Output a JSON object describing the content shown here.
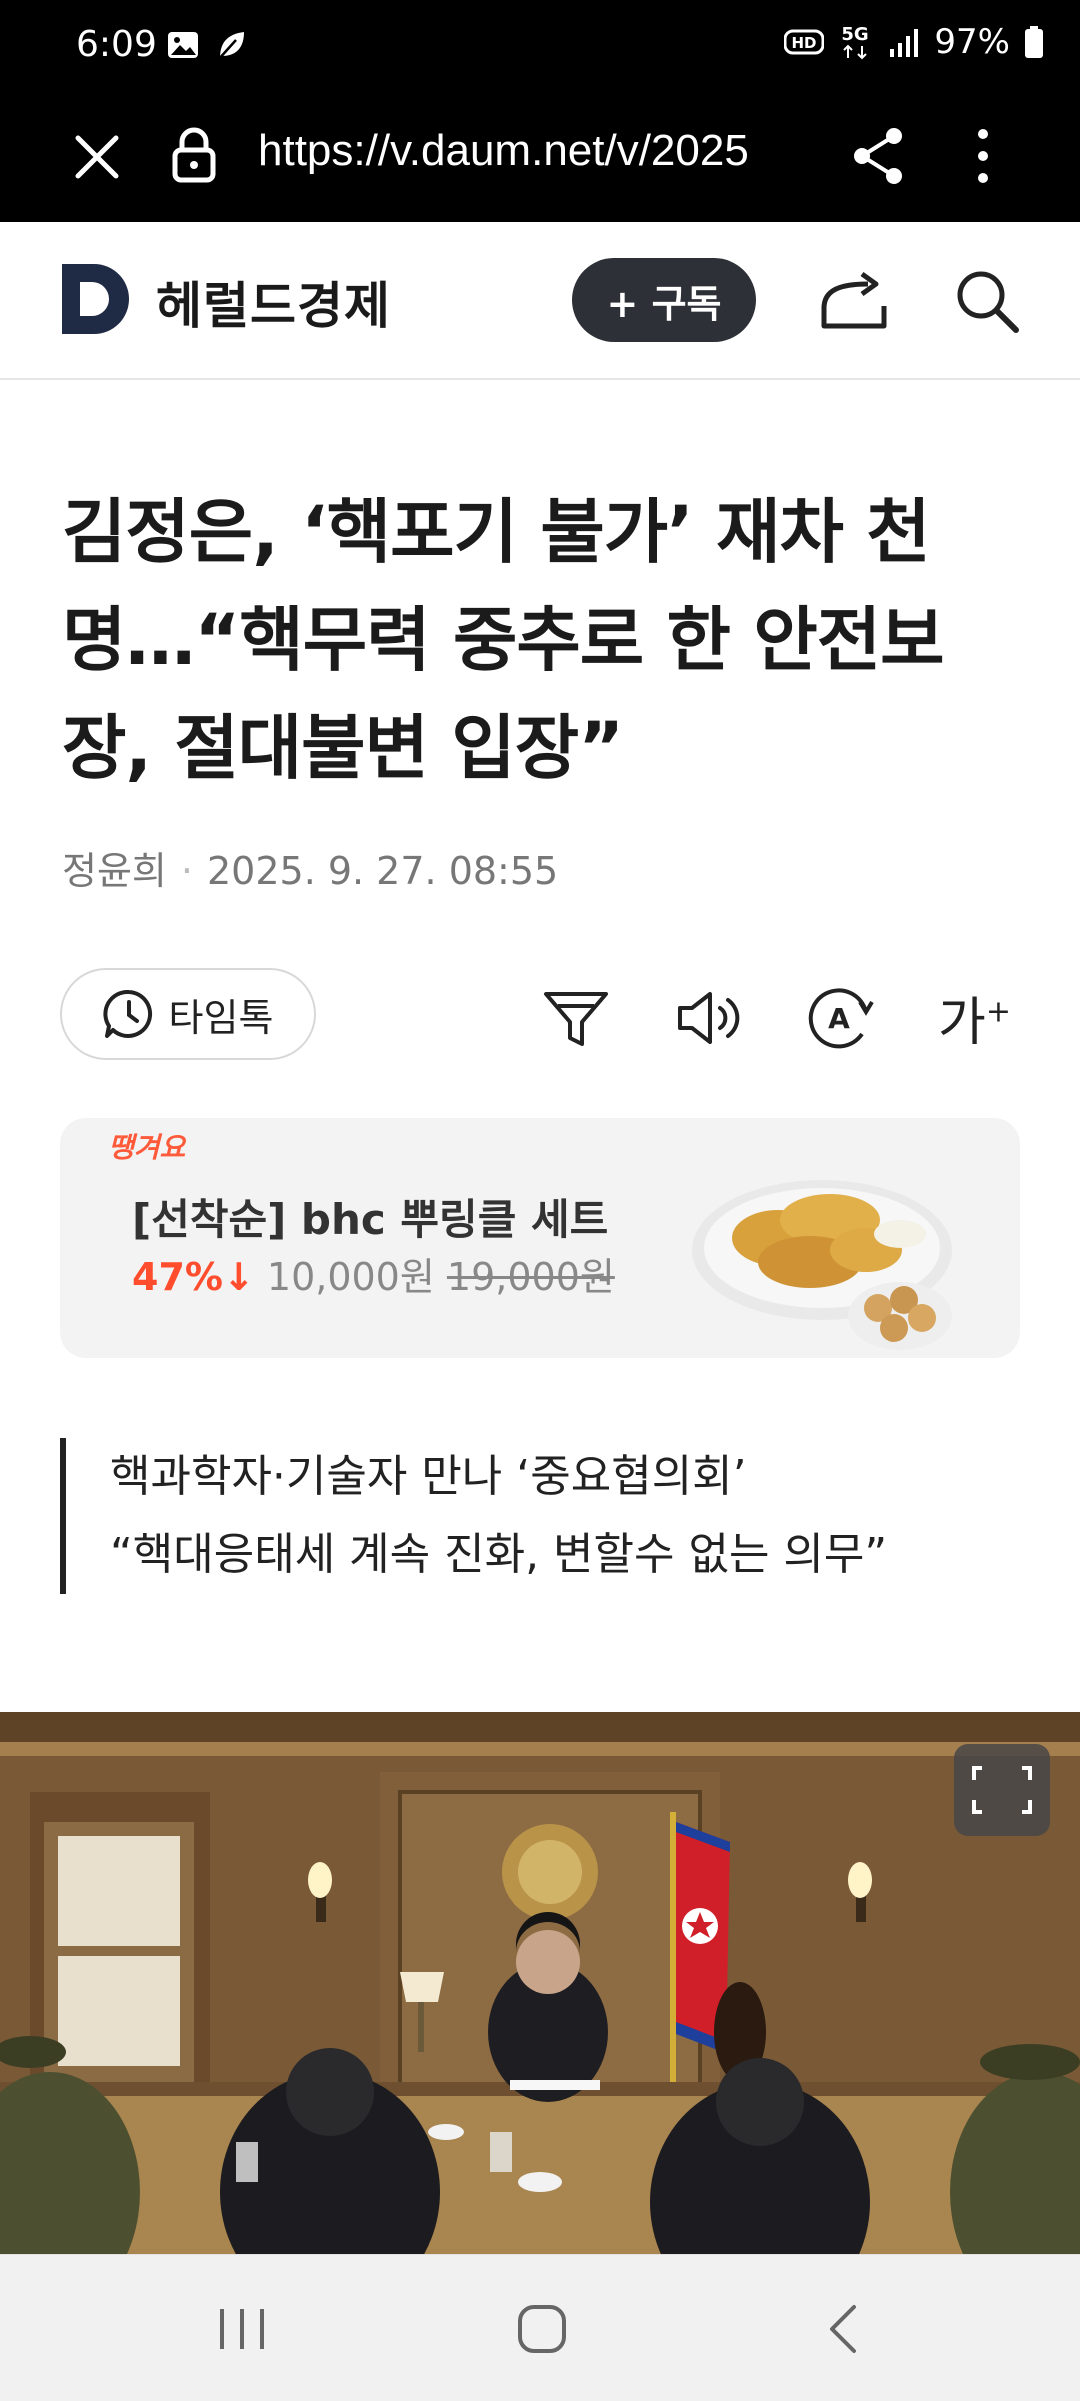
{
  "status_bar": {
    "time": "6:09",
    "network": "5G",
    "battery": "97%",
    "icons": [
      "gallery-icon",
      "leaf-icon",
      "hd-icon",
      "5g-icon",
      "signal-icon",
      "battery-icon"
    ]
  },
  "browser": {
    "url": "https://v.daum.net/v/2025"
  },
  "site": {
    "brand": "헤럴드경제",
    "subscribe_label": "+ 구독"
  },
  "article": {
    "headline": "김정은, ‘핵포기 불가’ 재차 천명…“핵무력 중추로 한 안전보장, 절대불변 입장”",
    "author": "정윤희",
    "datetime": "2025. 9. 27. 08:55",
    "summary_lines": [
      "핵과학자·기술자 만나 ‘중요협의회’",
      "“핵대응태세 계속 진화, 변할수 없는 의무”"
    ]
  },
  "toolbar": {
    "timetalk_label": "타임톡",
    "font_size_glyph": "가"
  },
  "ad": {
    "badge": "땡겨요",
    "title": "[선착순] bhc 뿌링클 세트",
    "discount": "47%↓",
    "price": "10,000원",
    "original_price": "19,000원"
  },
  "colors": {
    "accent_orange": "#ff4d2d",
    "subscribe_bg": "#2d3036",
    "logo_navy": "#1f2a44"
  }
}
